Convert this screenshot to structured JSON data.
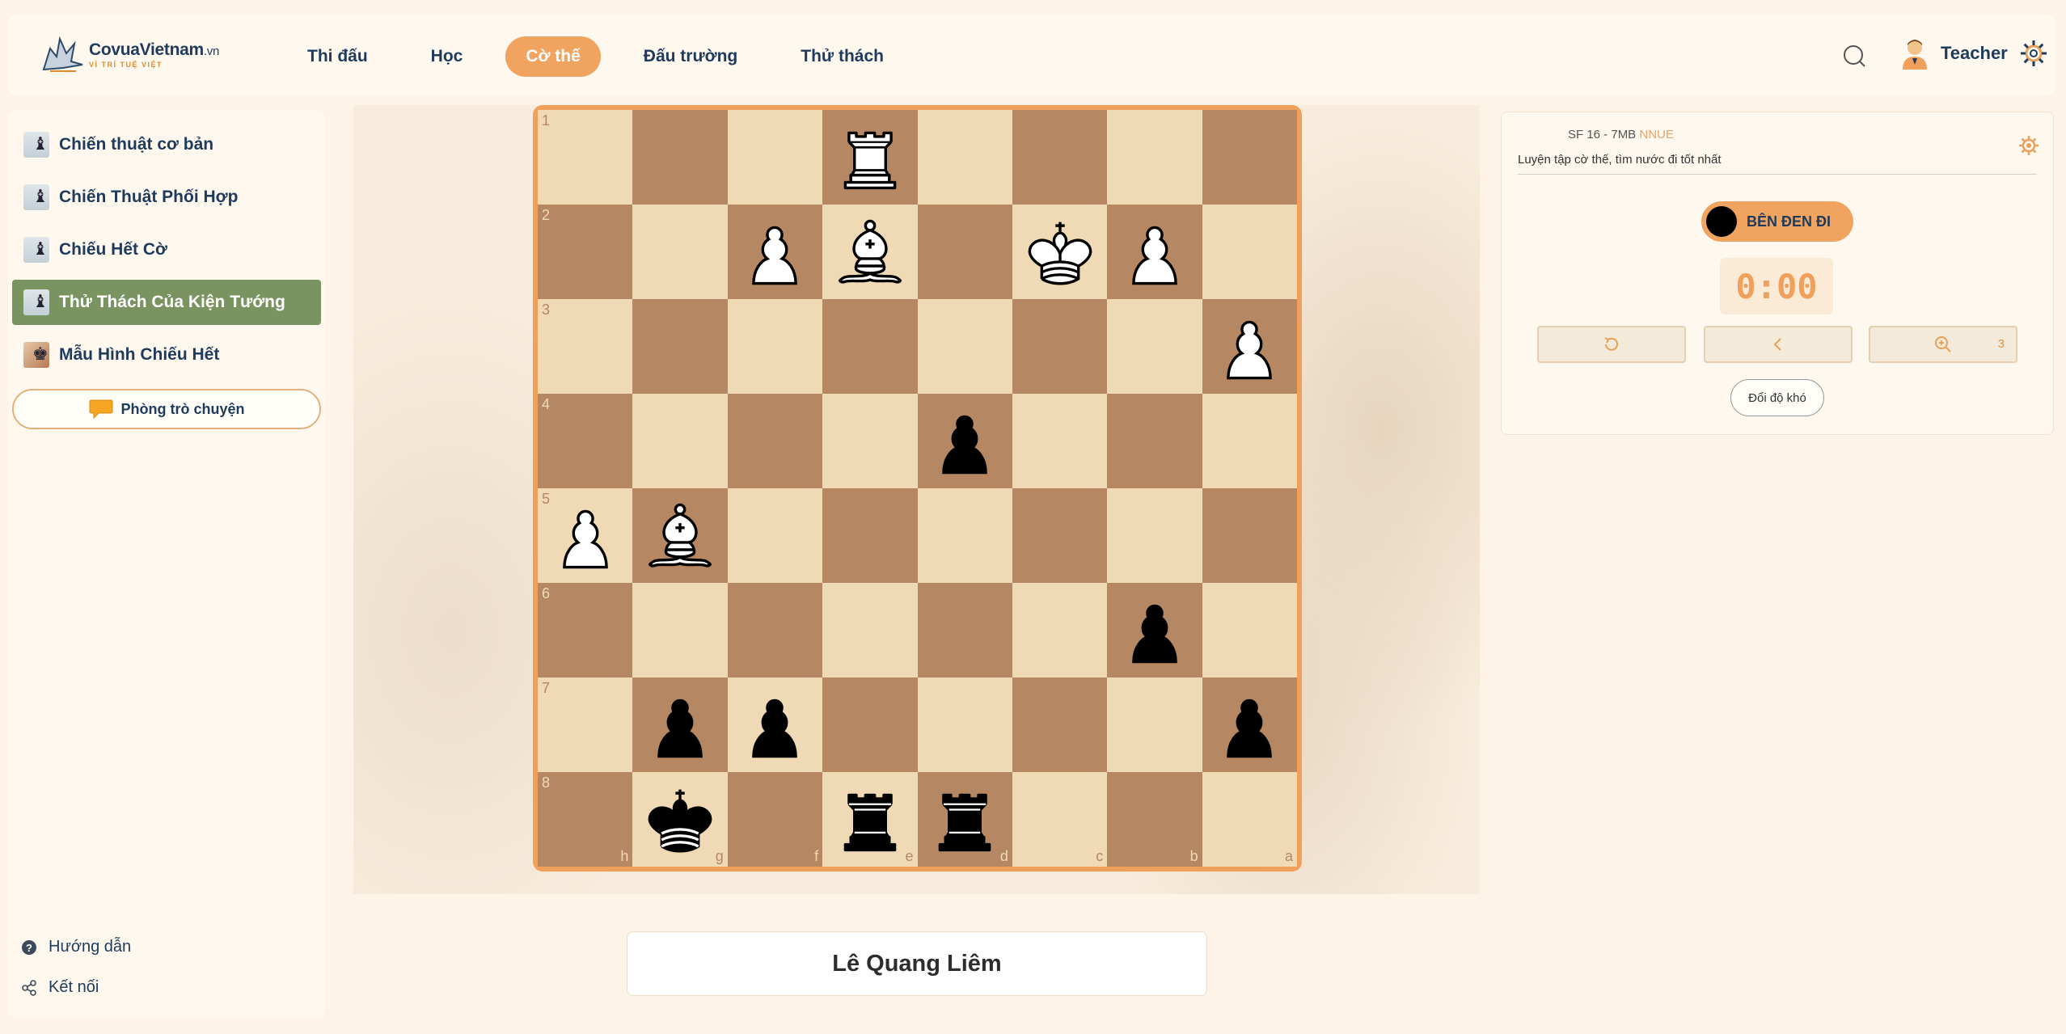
{
  "header": {
    "logo_name": "CovuaVietnam",
    "logo_domain": ".vn",
    "logo_tagline": "VÌ TRÍ TUỆ VIỆT",
    "nav": [
      {
        "label": "Thi đấu",
        "active": false
      },
      {
        "label": "Học",
        "active": false
      },
      {
        "label": "Cờ thế",
        "active": true
      },
      {
        "label": "Đấu trường",
        "active": false
      },
      {
        "label": "Thử thách",
        "active": false
      }
    ],
    "user_name": "Teacher",
    "icons": [
      "search-icon",
      "user-avatar-icon",
      "gear-icon"
    ]
  },
  "sidebar": {
    "items": [
      {
        "label": "Chiến thuật cơ bản",
        "active": false
      },
      {
        "label": "Chiến Thuật Phối Hợp",
        "active": false
      },
      {
        "label": "Chiếu Hết Cờ",
        "active": false
      },
      {
        "label": "Thử Thách Của Kiện Tướng",
        "active": true
      },
      {
        "label": "Mẫu Hình Chiếu Hết",
        "active": false
      }
    ],
    "chat_button": "Phòng trò chuyện",
    "footer": {
      "guide": "Hướng dẫn",
      "connect": "Kết nối"
    }
  },
  "board": {
    "ranks": [
      "1",
      "2",
      "3",
      "4",
      "5",
      "6",
      "7",
      "8"
    ],
    "files": [
      "h",
      "g",
      "f",
      "e",
      "d",
      "c",
      "b",
      "a"
    ],
    "pieces": [
      {
        "square": "e1",
        "type": "rook",
        "color": "white"
      },
      {
        "square": "f2",
        "type": "pawn",
        "color": "white"
      },
      {
        "square": "e2",
        "type": "bishop",
        "color": "white"
      },
      {
        "square": "c2",
        "type": "king",
        "color": "white"
      },
      {
        "square": "b2",
        "type": "pawn",
        "color": "white"
      },
      {
        "square": "a3",
        "type": "pawn",
        "color": "white"
      },
      {
        "square": "d4",
        "type": "pawn",
        "color": "black"
      },
      {
        "square": "h5",
        "type": "pawn",
        "color": "white"
      },
      {
        "square": "g5",
        "type": "bishop",
        "color": "white"
      },
      {
        "square": "b6",
        "type": "pawn",
        "color": "black"
      },
      {
        "square": "g7",
        "type": "pawn",
        "color": "black"
      },
      {
        "square": "f7",
        "type": "pawn",
        "color": "black"
      },
      {
        "square": "a7",
        "type": "pawn",
        "color": "black"
      },
      {
        "square": "g8",
        "type": "king",
        "color": "black"
      },
      {
        "square": "e8",
        "type": "rook",
        "color": "black"
      },
      {
        "square": "d8",
        "type": "rook",
        "color": "black"
      }
    ],
    "light_color": "#f0d9b5",
    "dark_color": "#b58863",
    "frame_color": "#f0a05b"
  },
  "player_name": "Lê Quang Liêm",
  "panel": {
    "engine": "SF 16 - 7MB",
    "engine_tag": "NNUE",
    "subtitle": "Luyện tập cờ thế, tìm nước đi tốt nhất",
    "turn_label": "BÊN ĐEN ĐI",
    "timer": "0:00",
    "hint_count": "3",
    "difficulty_button": "Đổi độ khó",
    "accent_color": "#f1a45f"
  }
}
